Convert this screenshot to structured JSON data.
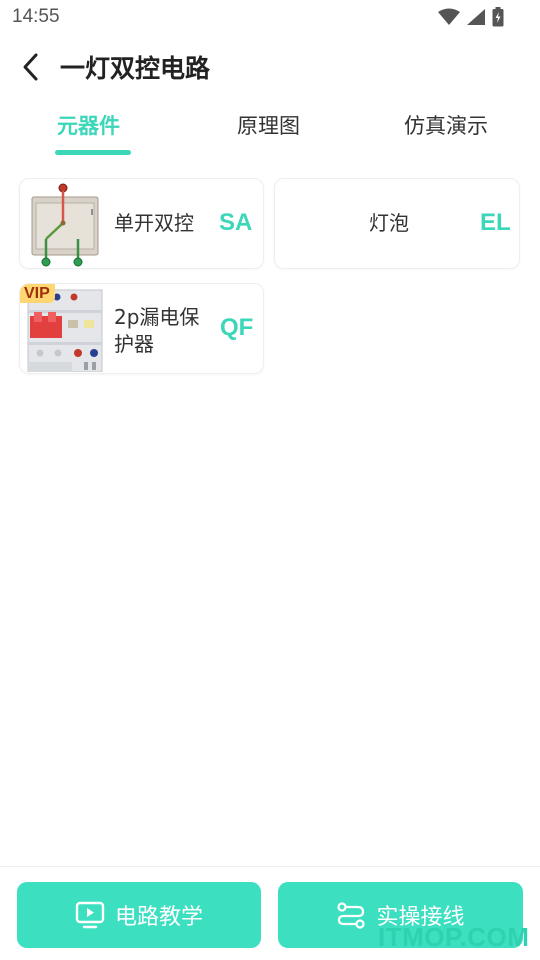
{
  "status_bar": {
    "time": "14:55"
  },
  "header": {
    "title": "一灯双控电路"
  },
  "tabs": [
    {
      "label": "元器件",
      "active": true
    },
    {
      "label": "原理图",
      "active": false
    },
    {
      "label": "仿真演示",
      "active": false
    }
  ],
  "components": [
    {
      "name": "单开双控",
      "code": "SA",
      "vip": false
    },
    {
      "name": "灯泡",
      "code": "EL",
      "vip": false
    },
    {
      "name_lines": [
        "2p漏电保",
        "护器"
      ],
      "code": "QF",
      "vip": true,
      "vip_label": "VIP"
    }
  ],
  "bottom": {
    "left_button": "电路教学",
    "right_button": "实操接线"
  },
  "watermark": "ITMOP.COM",
  "colors": {
    "accent": "#3cd6b8",
    "button": "#3ddfc1",
    "vip_bg": "#ffd772",
    "vip_text": "#a0300a"
  }
}
